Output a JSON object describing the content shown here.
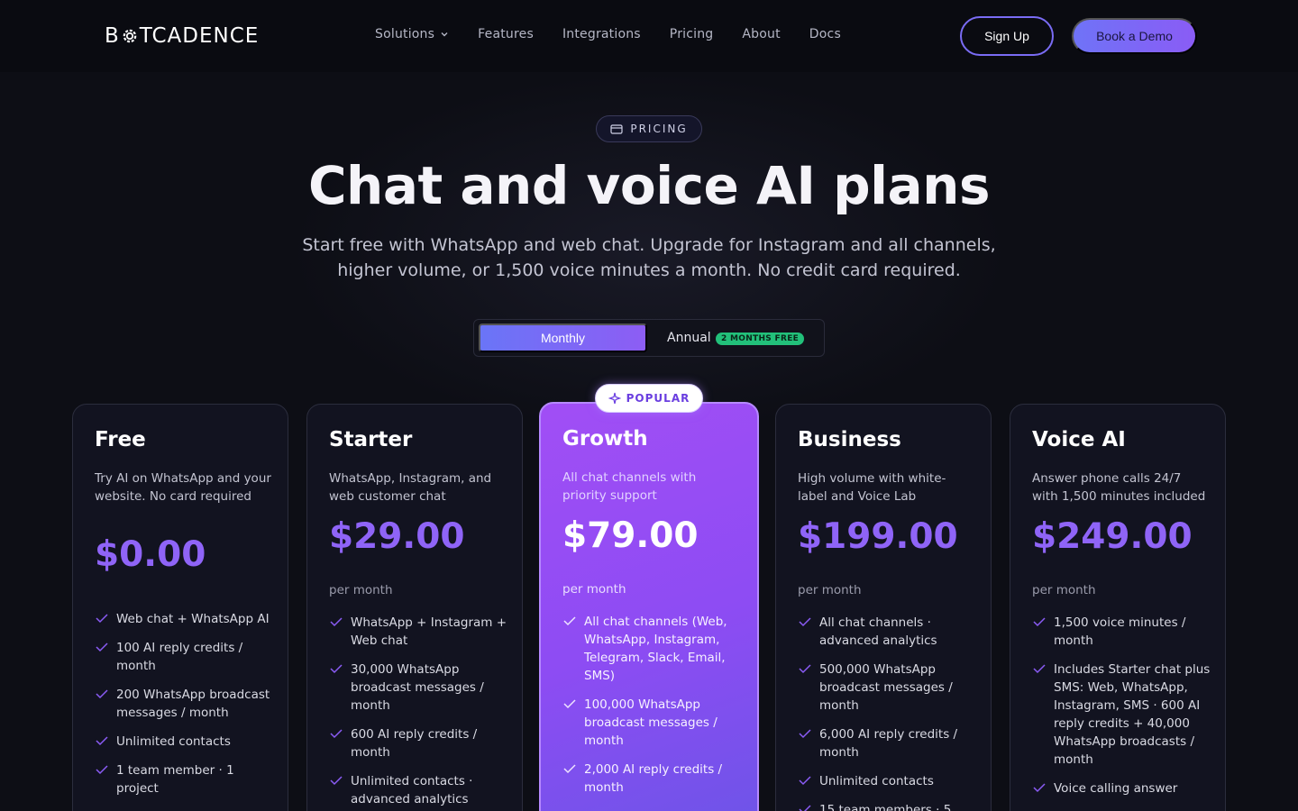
{
  "brand": {
    "logo_left": "B",
    "logo_right": "TCADENCE",
    "accent": "#8b5cf6"
  },
  "nav": {
    "links": [
      {
        "label": "Solutions",
        "has_dropdown": true
      },
      {
        "label": "Features"
      },
      {
        "label": "Integrations"
      },
      {
        "label": "Pricing"
      },
      {
        "label": "About"
      },
      {
        "label": "Docs"
      }
    ],
    "signup_label": "Sign Up",
    "demo_label": "Book a Demo"
  },
  "hero": {
    "pill_label": "PRICING",
    "title": "Chat and voice AI plans",
    "subtitle": "Start free with WhatsApp and web chat. Upgrade for Instagram and all channels, higher volume, or 1,500 voice minutes a month. No credit card required."
  },
  "billing_toggle": {
    "monthly_label": "Monthly",
    "annual_label": "Annual",
    "annual_badge": "2 MONTHS FREE",
    "selected": "Monthly"
  },
  "popular_badge": "POPULAR",
  "plans": [
    {
      "name": "Free",
      "description": "Try AI on WhatsApp and your website. No card required",
      "price": "$0.00",
      "period": "",
      "features": [
        "Web chat + WhatsApp AI",
        "100 AI reply credits / month",
        "200 WhatsApp broadcast messages / month",
        "Unlimited contacts",
        "1 team member · 1 project"
      ]
    },
    {
      "name": "Starter",
      "description": "WhatsApp, Instagram, and web customer chat",
      "price": "$29.00",
      "period": "per month",
      "features": [
        "WhatsApp + Instagram + Web chat",
        "30,000 WhatsApp broadcast messages / month",
        "600 AI reply credits / month",
        "Unlimited contacts · advanced analytics"
      ]
    },
    {
      "name": "Growth",
      "description": "All chat channels with priority support",
      "price": "$79.00",
      "period": "per month",
      "features": [
        "All chat channels (Web, WhatsApp, Instagram, Telegram, Slack, Email, SMS)",
        "100,000 WhatsApp broadcast messages / month",
        "2,000 AI reply credits / month"
      ]
    },
    {
      "name": "Business",
      "description": "High volume with white-label and Voice Lab",
      "price": "$199.00",
      "period": "per month",
      "features": [
        "All chat channels · advanced analytics",
        "500,000 WhatsApp broadcast messages / month",
        "6,000 AI reply credits / month",
        "Unlimited contacts",
        "15 team members · 5"
      ]
    },
    {
      "name": "Voice AI",
      "description": "Answer phone calls 24/7 with 1,500 minutes included",
      "price": "$249.00",
      "period": "per month",
      "features": [
        "1,500 voice minutes / month",
        "Includes Starter chat plus SMS: Web, WhatsApp, Instagram, SMS · 600 AI reply credits + 40,000 WhatsApp broadcasts / month",
        "Voice calling answer"
      ]
    }
  ]
}
